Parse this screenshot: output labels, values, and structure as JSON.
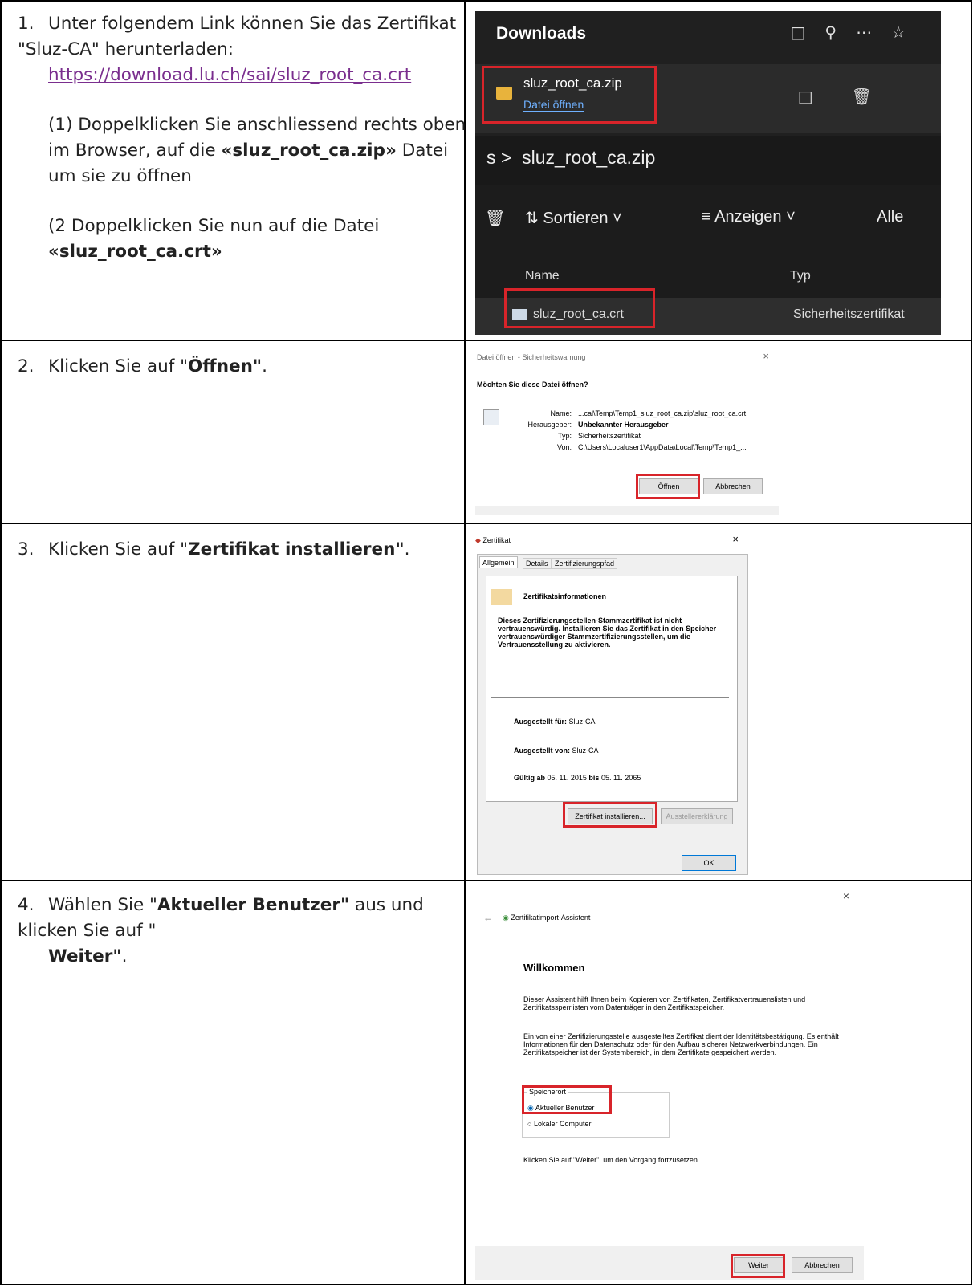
{
  "steps": [
    {
      "number": "1.",
      "text": "Unter folgendem Link können Sie das Zertifikat \"Sluz-CA\" herunterladen:",
      "link": "https://download.lu.ch/sai/sluz_root_ca.crt",
      "sub1_pre": "(1) Doppelklicken Sie anschliessend rechts oben im Browser, auf die",
      "sub1_bold": "«sluz_root_ca.zip»",
      "sub1_post": "Datei um sie zu öffnen",
      "sub2_pre": "(2 Doppelklicken Sie nun auf die Datei",
      "sub2_bold": "«sluz_root_ca.crt»"
    },
    {
      "number": "2.",
      "pre": "Klicken Sie auf \"",
      "bold": "Öffnen\"",
      "post": "."
    },
    {
      "number": "3.",
      "pre": "Klicken Sie auf \"",
      "bold": "Zertifikat installieren\"",
      "post": "."
    },
    {
      "number": "4.",
      "pre": "Wählen Sie \"",
      "bold": "Aktueller Benutzer\"",
      "mid": " aus und klicken Sie auf \"",
      "bold2": "Weiter\"",
      "post": "."
    }
  ],
  "shot1": {
    "downloads_title": "Downloads",
    "file_name": "sluz_root_ca.zip",
    "open_file": "Datei öffnen",
    "path_sep": "s  >",
    "path_name": "sluz_root_ca.zip",
    "sort": "⇅ Sortieren ˅",
    "view": "≡ Anzeigen ˅",
    "all": "Alle",
    "col_name": "Name",
    "col_type": "Typ",
    "row_name": "sluz_root_ca.crt",
    "row_type": "Sicherheitszertifikat"
  },
  "shot2": {
    "title": "Datei öffnen - Sicherheitswarnung",
    "question": "Möchten Sie diese Datei öffnen?",
    "name_label": "Name:",
    "name_value": "...cal\\Temp\\Temp1_sluz_root_ca.zip\\sluz_root_ca.crt",
    "publisher_label": "Herausgeber:",
    "publisher_value": "Unbekannter Herausgeber",
    "type_label": "Typ:",
    "type_value": "Sicherheitszertifikat",
    "from_label": "Von:",
    "from_value": "C:\\Users\\Localuser1\\AppData\\Local\\Temp\\Temp1_...",
    "open_btn": "Öffnen",
    "cancel_btn": "Abbrechen"
  },
  "shot3": {
    "title": "Zertifikat",
    "tabs": [
      "Allgemein",
      "Details",
      "Zertifizierungspfad"
    ],
    "info_title": "Zertifikatsinformationen",
    "warning": "Dieses Zertifizierungsstellen-Stammzertifikat ist nicht vertrauenswürdig. Installieren Sie das Zertifikat in den Speicher vertrauenswürdiger Stammzertifizierungsstellen, um die Vertrauensstellung zu aktivieren.",
    "issued_to_label": "Ausgestellt für:",
    "issued_to": "Sluz-CA",
    "issued_by_label": "Ausgestellt von:",
    "issued_by": "Sluz-CA",
    "valid_label": "Gültig ab",
    "valid_from": "05. 11. 2015",
    "valid_bis": "bis",
    "valid_to": "05. 11. 2065",
    "install_btn": "Zertifikat installieren...",
    "issuer_btn": "Ausstellererklärung",
    "ok_btn": "OK"
  },
  "shot4": {
    "wizard_title": "Zertifikatimport-Assistent",
    "heading": "Willkommen",
    "para1": "Dieser Assistent hilft Ihnen beim Kopieren von Zertifikaten, Zertifikatvertrauenslisten und Zertifikatssperrlisten vom Datenträger in den Zertifikatspeicher.",
    "para2": "Ein von einer Zertifizierungsstelle ausgestelltes Zertifikat dient der Identitätsbestätigung. Es enthält Informationen für den Datenschutz oder für den Aufbau sicherer Netzwerkverbindungen. Ein Zertifikatspeicher ist der Systembereich, in dem Zertifikate gespeichert werden.",
    "group": "Speicherort",
    "opt_current": "Aktueller Benutzer",
    "opt_local": "Lokaler Computer",
    "continue": "Klicken Sie auf \"Weiter\", um den Vorgang fortzusetzen.",
    "next_btn": "Weiter",
    "cancel_btn": "Abbrechen"
  }
}
